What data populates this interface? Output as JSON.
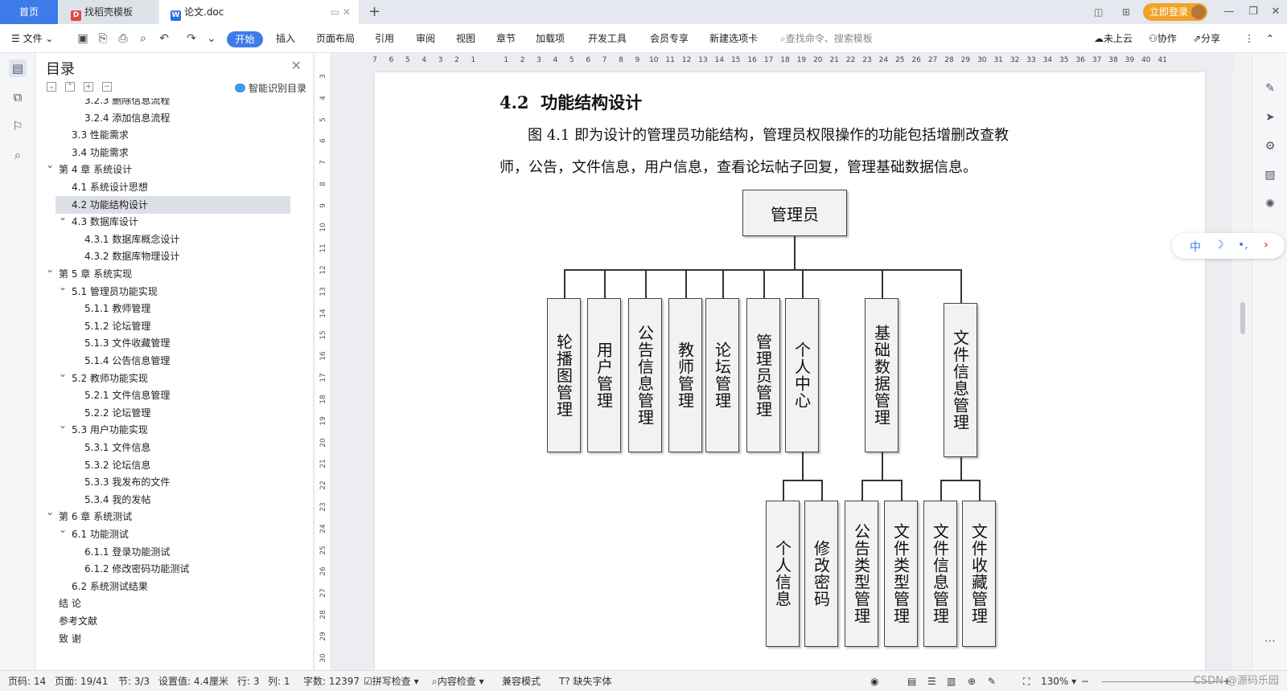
{
  "tabs": {
    "home": "首页",
    "template": "找稻壳模板",
    "doc": "论文.doc",
    "new_tab": "+",
    "login": "立即登录"
  },
  "toolbar": {
    "file": "文件",
    "menus": [
      "开始",
      "插入",
      "页面布局",
      "引用",
      "审阅",
      "视图",
      "章节",
      "加载项",
      "开发工具",
      "会员专享",
      "新建选项卡"
    ],
    "search_placeholder": "查找命令、搜索模板",
    "cloud": "未上云",
    "collab": "协作",
    "share": "分享"
  },
  "toc": {
    "title": "目录",
    "smart": "智能识别目录",
    "items": [
      {
        "label": "3.2.3 删除信息流程",
        "level": 3,
        "selected": false
      },
      {
        "label": "3.2.4 添加信息流程",
        "level": 3,
        "selected": false
      },
      {
        "label": "3.3 性能需求",
        "level": 2,
        "selected": false
      },
      {
        "label": "3.4 功能需求",
        "level": 2,
        "selected": false
      },
      {
        "label": "第 4 章 系统设计",
        "level": 1,
        "selected": false
      },
      {
        "label": "4.1 系统设计思想",
        "level": 2,
        "selected": false
      },
      {
        "label": "4.2 功能结构设计",
        "level": 2,
        "selected": true
      },
      {
        "label": "4.3 数据库设计",
        "level": 2,
        "selected": false
      },
      {
        "label": "4.3.1 数据库概念设计",
        "level": 3,
        "selected": false
      },
      {
        "label": "4.3.2 数据库物理设计",
        "level": 3,
        "selected": false
      },
      {
        "label": "第 5 章 系统实现",
        "level": 1,
        "selected": false
      },
      {
        "label": "5.1 管理员功能实现",
        "level": 2,
        "selected": false
      },
      {
        "label": "5.1.1 教师管理",
        "level": 3,
        "selected": false
      },
      {
        "label": "5.1.2 论坛管理",
        "level": 3,
        "selected": false
      },
      {
        "label": "5.1.3 文件收藏管理",
        "level": 3,
        "selected": false
      },
      {
        "label": "5.1.4 公告信息管理",
        "level": 3,
        "selected": false
      },
      {
        "label": "5.2 教师功能实现",
        "level": 2,
        "selected": false
      },
      {
        "label": "5.2.1 文件信息管理",
        "level": 3,
        "selected": false
      },
      {
        "label": "5.2.2 论坛管理",
        "level": 3,
        "selected": false
      },
      {
        "label": "5.3 用户功能实现",
        "level": 2,
        "selected": false
      },
      {
        "label": "5.3.1 文件信息",
        "level": 3,
        "selected": false
      },
      {
        "label": "5.3.2 论坛信息",
        "level": 3,
        "selected": false
      },
      {
        "label": "5.3.3 我发布的文件",
        "level": 3,
        "selected": false
      },
      {
        "label": "5.3.4 我的发帖",
        "level": 3,
        "selected": false
      },
      {
        "label": "第 6 章 系统测试",
        "level": 1,
        "selected": false
      },
      {
        "label": "6.1 功能测试",
        "level": 2,
        "selected": false
      },
      {
        "label": "6.1.1 登录功能测试",
        "level": 3,
        "selected": false
      },
      {
        "label": "6.1.2 修改密码功能测试",
        "level": 3,
        "selected": false
      },
      {
        "label": "6.2 系统测试结果",
        "level": 2,
        "selected": false
      },
      {
        "label": "结 论",
        "level": 1,
        "selected": false
      },
      {
        "label": "参考文献",
        "level": 1,
        "selected": false
      },
      {
        "label": "致 谢",
        "level": 1,
        "selected": false
      }
    ]
  },
  "ruler_h": [
    "7",
    "6",
    "5",
    "4",
    "3",
    "2",
    "1",
    "",
    "1",
    "2",
    "3",
    "4",
    "5",
    "6",
    "7",
    "8",
    "9",
    "10",
    "11",
    "12",
    "13",
    "14",
    "15",
    "16",
    "17",
    "18",
    "19",
    "20",
    "21",
    "22",
    "23",
    "24",
    "25",
    "26",
    "27",
    "28",
    "29",
    "30",
    "31",
    "32",
    "33",
    "34",
    "35",
    "36",
    "37",
    "38",
    "39",
    "40",
    "41"
  ],
  "ruler_v": [
    "3",
    "4",
    "5",
    "6",
    "7",
    "8",
    "9",
    "10",
    "11",
    "12",
    "13",
    "14",
    "15",
    "16",
    "17",
    "18",
    "19",
    "20",
    "21",
    "22",
    "23",
    "24",
    "25",
    "26",
    "27",
    "28",
    "29",
    "30"
  ],
  "document": {
    "heading_num": "4.2",
    "heading": "功能结构设计",
    "para_line1": "图 4.1 即为设计的管理员功能结构，管理员权限操作的功能包括增删改查教",
    "para_line2": "师，公告，文件信息，用户信息，查看论坛帖子回复，管理基础数据信息。"
  },
  "diagram": {
    "root": "管理员",
    "level1": [
      "轮播图管理",
      "用户管理",
      "公告信息管理",
      "教师管理",
      "论坛管理",
      "管理员管理",
      "个人中心",
      "基础数据管理",
      "文件信息管理"
    ],
    "level2": [
      "个人信息",
      "修改密码",
      "公告类型管理",
      "文件类型管理",
      "文件信息管理",
      "文件收藏管理"
    ]
  },
  "float_toolbar": [
    "中",
    "☽",
    "•,",
    "›"
  ],
  "status": {
    "page_code": "页码: 14",
    "page": "页面: 19/41",
    "section": "节: 3/3",
    "setting": "设置值: 4.4厘米",
    "row": "行: 3",
    "col": "列: 1",
    "words": "字数: 12397",
    "spell": "拼写检查",
    "content_check": "内容检查",
    "compat": "兼容模式",
    "missing_font": "缺失字体",
    "zoom": "130%",
    "watermark": "CSDN @源码乐园"
  }
}
